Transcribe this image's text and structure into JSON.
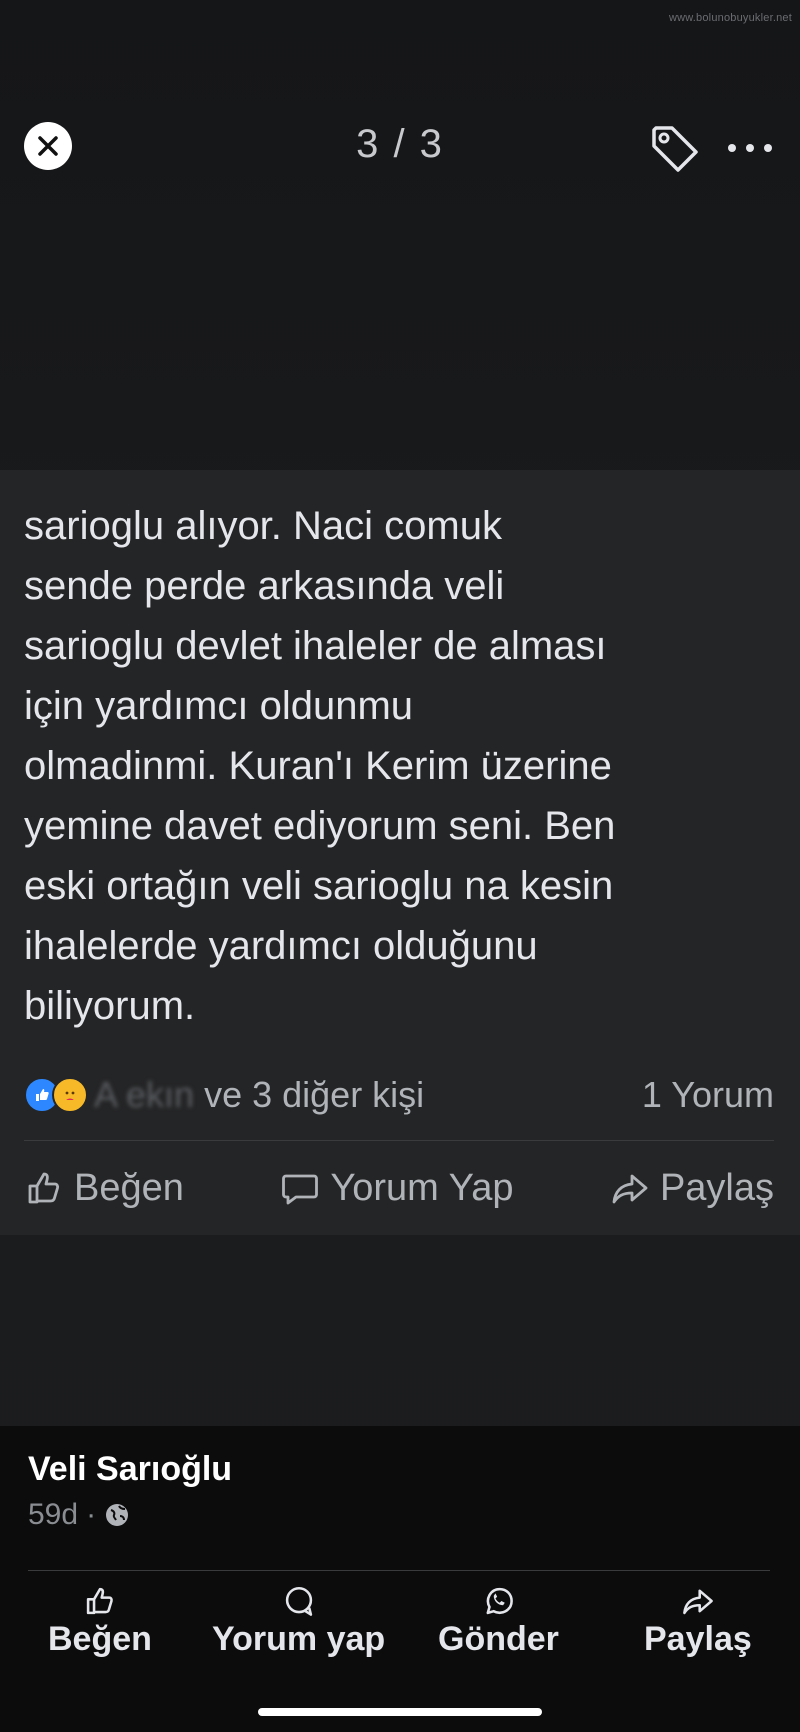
{
  "watermark": "www.bolunobuyukler.net",
  "viewer": {
    "counter": "3 / 3"
  },
  "post": {
    "text": "sarioglu alıyor. Naci comuk\nsende perde arkasında veli\nsarioglu devlet ihaleler de alması\niçin yardımcı oldunmu\nolmadinmi. Kuran'ı Kerim üzerine\nyemine davet ediyorum seni. Ben\neski ortağın veli sarioglu na kesin\nihalelerde yardımcı olduğunu\nbiliyorum.",
    "reactions_blurred": "A     ekın",
    "reactions_suffix": " ve 3 diğer kişi",
    "comments": "1 Yorum",
    "actions": {
      "like": "Beğen",
      "comment": "Yorum Yap",
      "share": "Paylaş"
    }
  },
  "author": {
    "name": "Veli Sarıoğlu",
    "time": "59d",
    "separator": "·"
  },
  "bottom_actions": {
    "like": "Beğen",
    "comment": "Yorum yap",
    "send": "Gönder",
    "share": "Paylaş"
  },
  "icons": {
    "close": "close-icon",
    "tag": "tag-icon",
    "more": "more-icon",
    "globe": "globe-icon"
  },
  "colors": {
    "like_blue": "#2d88ff",
    "care_yellow": "#f7b928"
  }
}
